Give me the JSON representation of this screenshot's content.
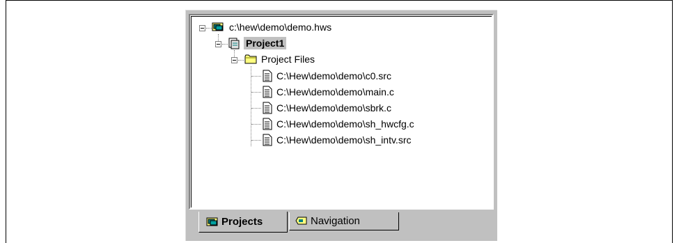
{
  "workspace": {
    "root_label": "c:\\hew\\demo\\demo.hws",
    "project_label": "Project1",
    "folder_label": "Project Files",
    "files": [
      "C:\\Hew\\demo\\demo\\c0.src",
      "C:\\Hew\\demo\\demo\\main.c",
      "C:\\Hew\\demo\\demo\\sbrk.c",
      "C:\\Hew\\demo\\demo\\sh_hwcfg.c",
      "C:\\Hew\\demo\\demo\\sh_intv.src"
    ]
  },
  "tabs": {
    "projects_label": "Projects",
    "navigation_label": "Navigation"
  },
  "icons": [
    "workspace-icon",
    "project-icon",
    "folder-icon",
    "file-icon",
    "navigation-icon"
  ],
  "colors": {
    "window_bg": "#c0c0c0",
    "tree_bg": "#ffffff",
    "selection_bg": "#c0c0c0"
  }
}
